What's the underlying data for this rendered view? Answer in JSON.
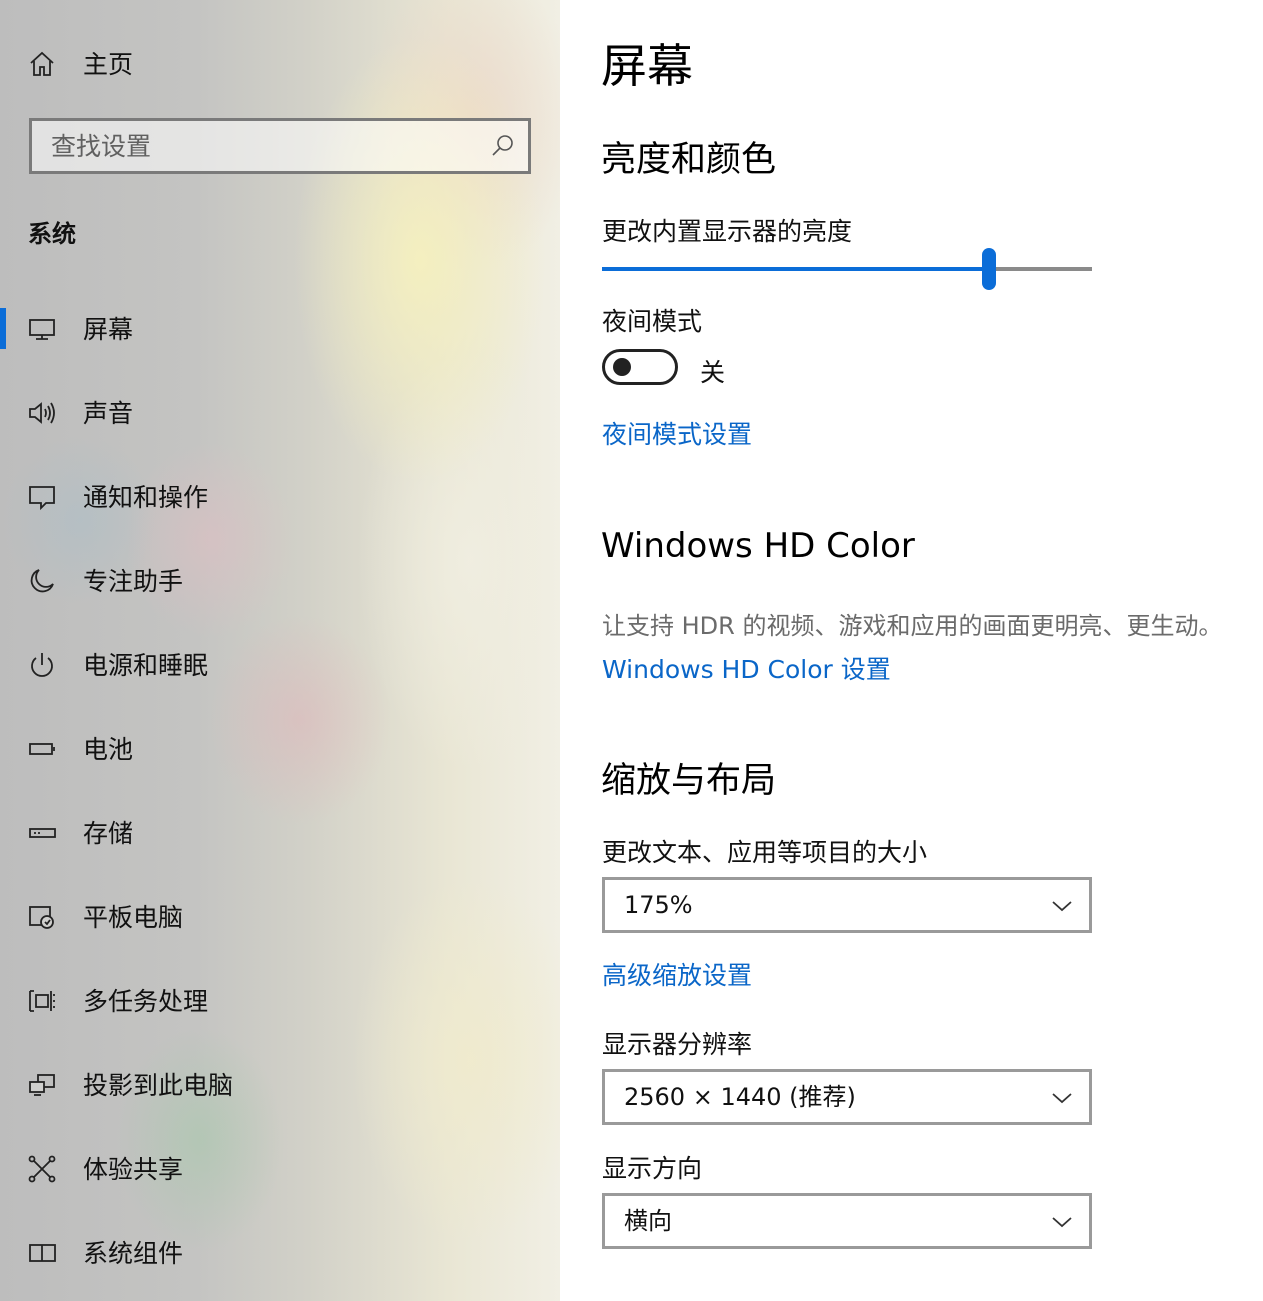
{
  "sidebar": {
    "home_label": "主页",
    "search_placeholder": "查找设置",
    "section_heading": "系统",
    "items": [
      {
        "label": "屏幕",
        "icon": "monitor-icon",
        "active": true
      },
      {
        "label": "声音",
        "icon": "speaker-icon"
      },
      {
        "label": "通知和操作",
        "icon": "notification-icon"
      },
      {
        "label": "专注助手",
        "icon": "moon-icon"
      },
      {
        "label": "电源和睡眠",
        "icon": "power-icon"
      },
      {
        "label": "电池",
        "icon": "battery-icon"
      },
      {
        "label": "存储",
        "icon": "storage-drive-icon"
      },
      {
        "label": "平板电脑",
        "icon": "tablet-mode-icon"
      },
      {
        "label": "多任务处理",
        "icon": "multitasking-icon"
      },
      {
        "label": "投影到此电脑",
        "icon": "project-to-pc-icon"
      },
      {
        "label": "体验共享",
        "icon": "shared-experiences-icon"
      },
      {
        "label": "系统组件",
        "icon": "system-components-icon"
      }
    ]
  },
  "main": {
    "page_title": "屏幕",
    "brightness_section": {
      "title": "亮度和颜色",
      "brightness_label": "更改内置显示器的亮度",
      "brightness_value": 0.79,
      "night_light_label": "夜间模式",
      "night_light_state": "关",
      "night_light_settings_link": "夜间模式设置"
    },
    "hdr_section": {
      "title": "Windows HD Color",
      "description": "让支持 HDR 的视频、游戏和应用的画面更明亮、更生动。",
      "settings_link": "Windows HD Color 设置"
    },
    "layout_section": {
      "title": "缩放与布局",
      "scale_label": "更改文本、应用等项目的大小",
      "scale_value": "175%",
      "advanced_scaling_link": "高级缩放设置",
      "resolution_label": "显示器分辨率",
      "resolution_value": "2560 × 1440 (推荐)",
      "orientation_label": "显示方向",
      "orientation_value": "横向"
    }
  },
  "colors": {
    "accent": "#0b6dd8",
    "link": "#0a66c8"
  }
}
